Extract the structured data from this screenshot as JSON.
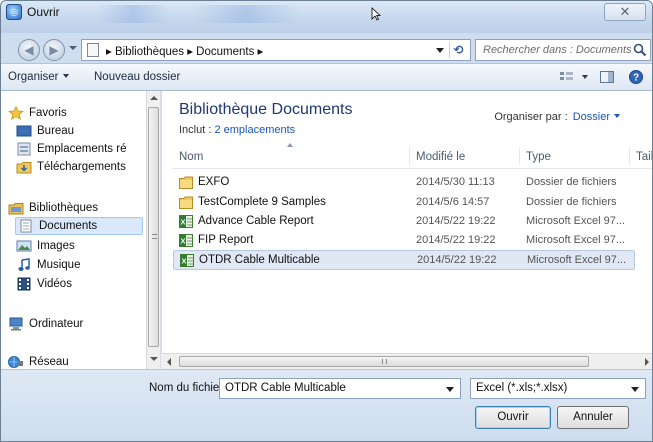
{
  "window": {
    "title": "Ouvrir",
    "close_glyph": "✕"
  },
  "address": {
    "path": "▸ Bibliothèques ▸ Documents ▸",
    "refresh_glyph": "⟲"
  },
  "search": {
    "placeholder": "Rechercher dans : Documents"
  },
  "toolbar": {
    "organize_label": "Organiser",
    "new_folder_label": "Nouveau dossier"
  },
  "sidebar": {
    "items": [
      {
        "label": "Favoris",
        "icon": "star-icon"
      },
      {
        "label": "Bureau",
        "icon": "desktop-icon"
      },
      {
        "label": "Emplacements ré",
        "icon": "recent-places-icon"
      },
      {
        "label": "Téléchargements",
        "icon": "downloads-icon"
      },
      {
        "label": "Bibliothèques",
        "icon": "libraries-icon"
      },
      {
        "label": "Documents",
        "icon": "documents-icon",
        "selected": true
      },
      {
        "label": "Images",
        "icon": "images-icon"
      },
      {
        "label": "Musique",
        "icon": "music-icon"
      },
      {
        "label": "Vidéos",
        "icon": "videos-icon"
      },
      {
        "label": "Ordinateur",
        "icon": "computer-icon"
      },
      {
        "label": "Réseau",
        "icon": "network-icon"
      }
    ]
  },
  "library": {
    "title": "Bibliothèque Documents",
    "include_prefix": "Inclut :",
    "include_link": "2 emplacements",
    "arrange_label": "Organiser par :",
    "arrange_value": "Dossier"
  },
  "columns": {
    "name": "Nom",
    "modified": "Modifié le",
    "type": "Type",
    "size": "Tail"
  },
  "files": [
    {
      "name": "EXFO",
      "modified": "2014/5/30 11:13",
      "type": "Dossier de fichiers",
      "icon": "folder-icon"
    },
    {
      "name": "TestComplete 9 Samples",
      "modified": "2014/5/6 14:57",
      "type": "Dossier de fichiers",
      "icon": "folder-icon"
    },
    {
      "name": "Advance Cable Report",
      "modified": "2014/5/22 19:22",
      "type": "Microsoft Excel 97...",
      "icon": "excel-file-icon"
    },
    {
      "name": "FIP Report",
      "modified": "2014/5/22 19:22",
      "type": "Microsoft Excel 97...",
      "icon": "excel-file-icon"
    },
    {
      "name": "OTDR Cable Multicable",
      "modified": "2014/5/22 19:22",
      "type": "Microsoft Excel 97...",
      "icon": "excel-file-icon",
      "selected": true
    }
  ],
  "bottom": {
    "filename_label": "Nom du fichier :",
    "filename_value": "OTDR Cable Multicable",
    "filetype_value": "Excel (*.xls;*.xlsx)",
    "open_label": "Ouvrir",
    "cancel_label": "Annuler"
  },
  "colors": {
    "accent_link": "#1a56b8",
    "title_blue": "#1e3a73",
    "selection": "#d9e8fb",
    "frame": "#cfdeef"
  }
}
